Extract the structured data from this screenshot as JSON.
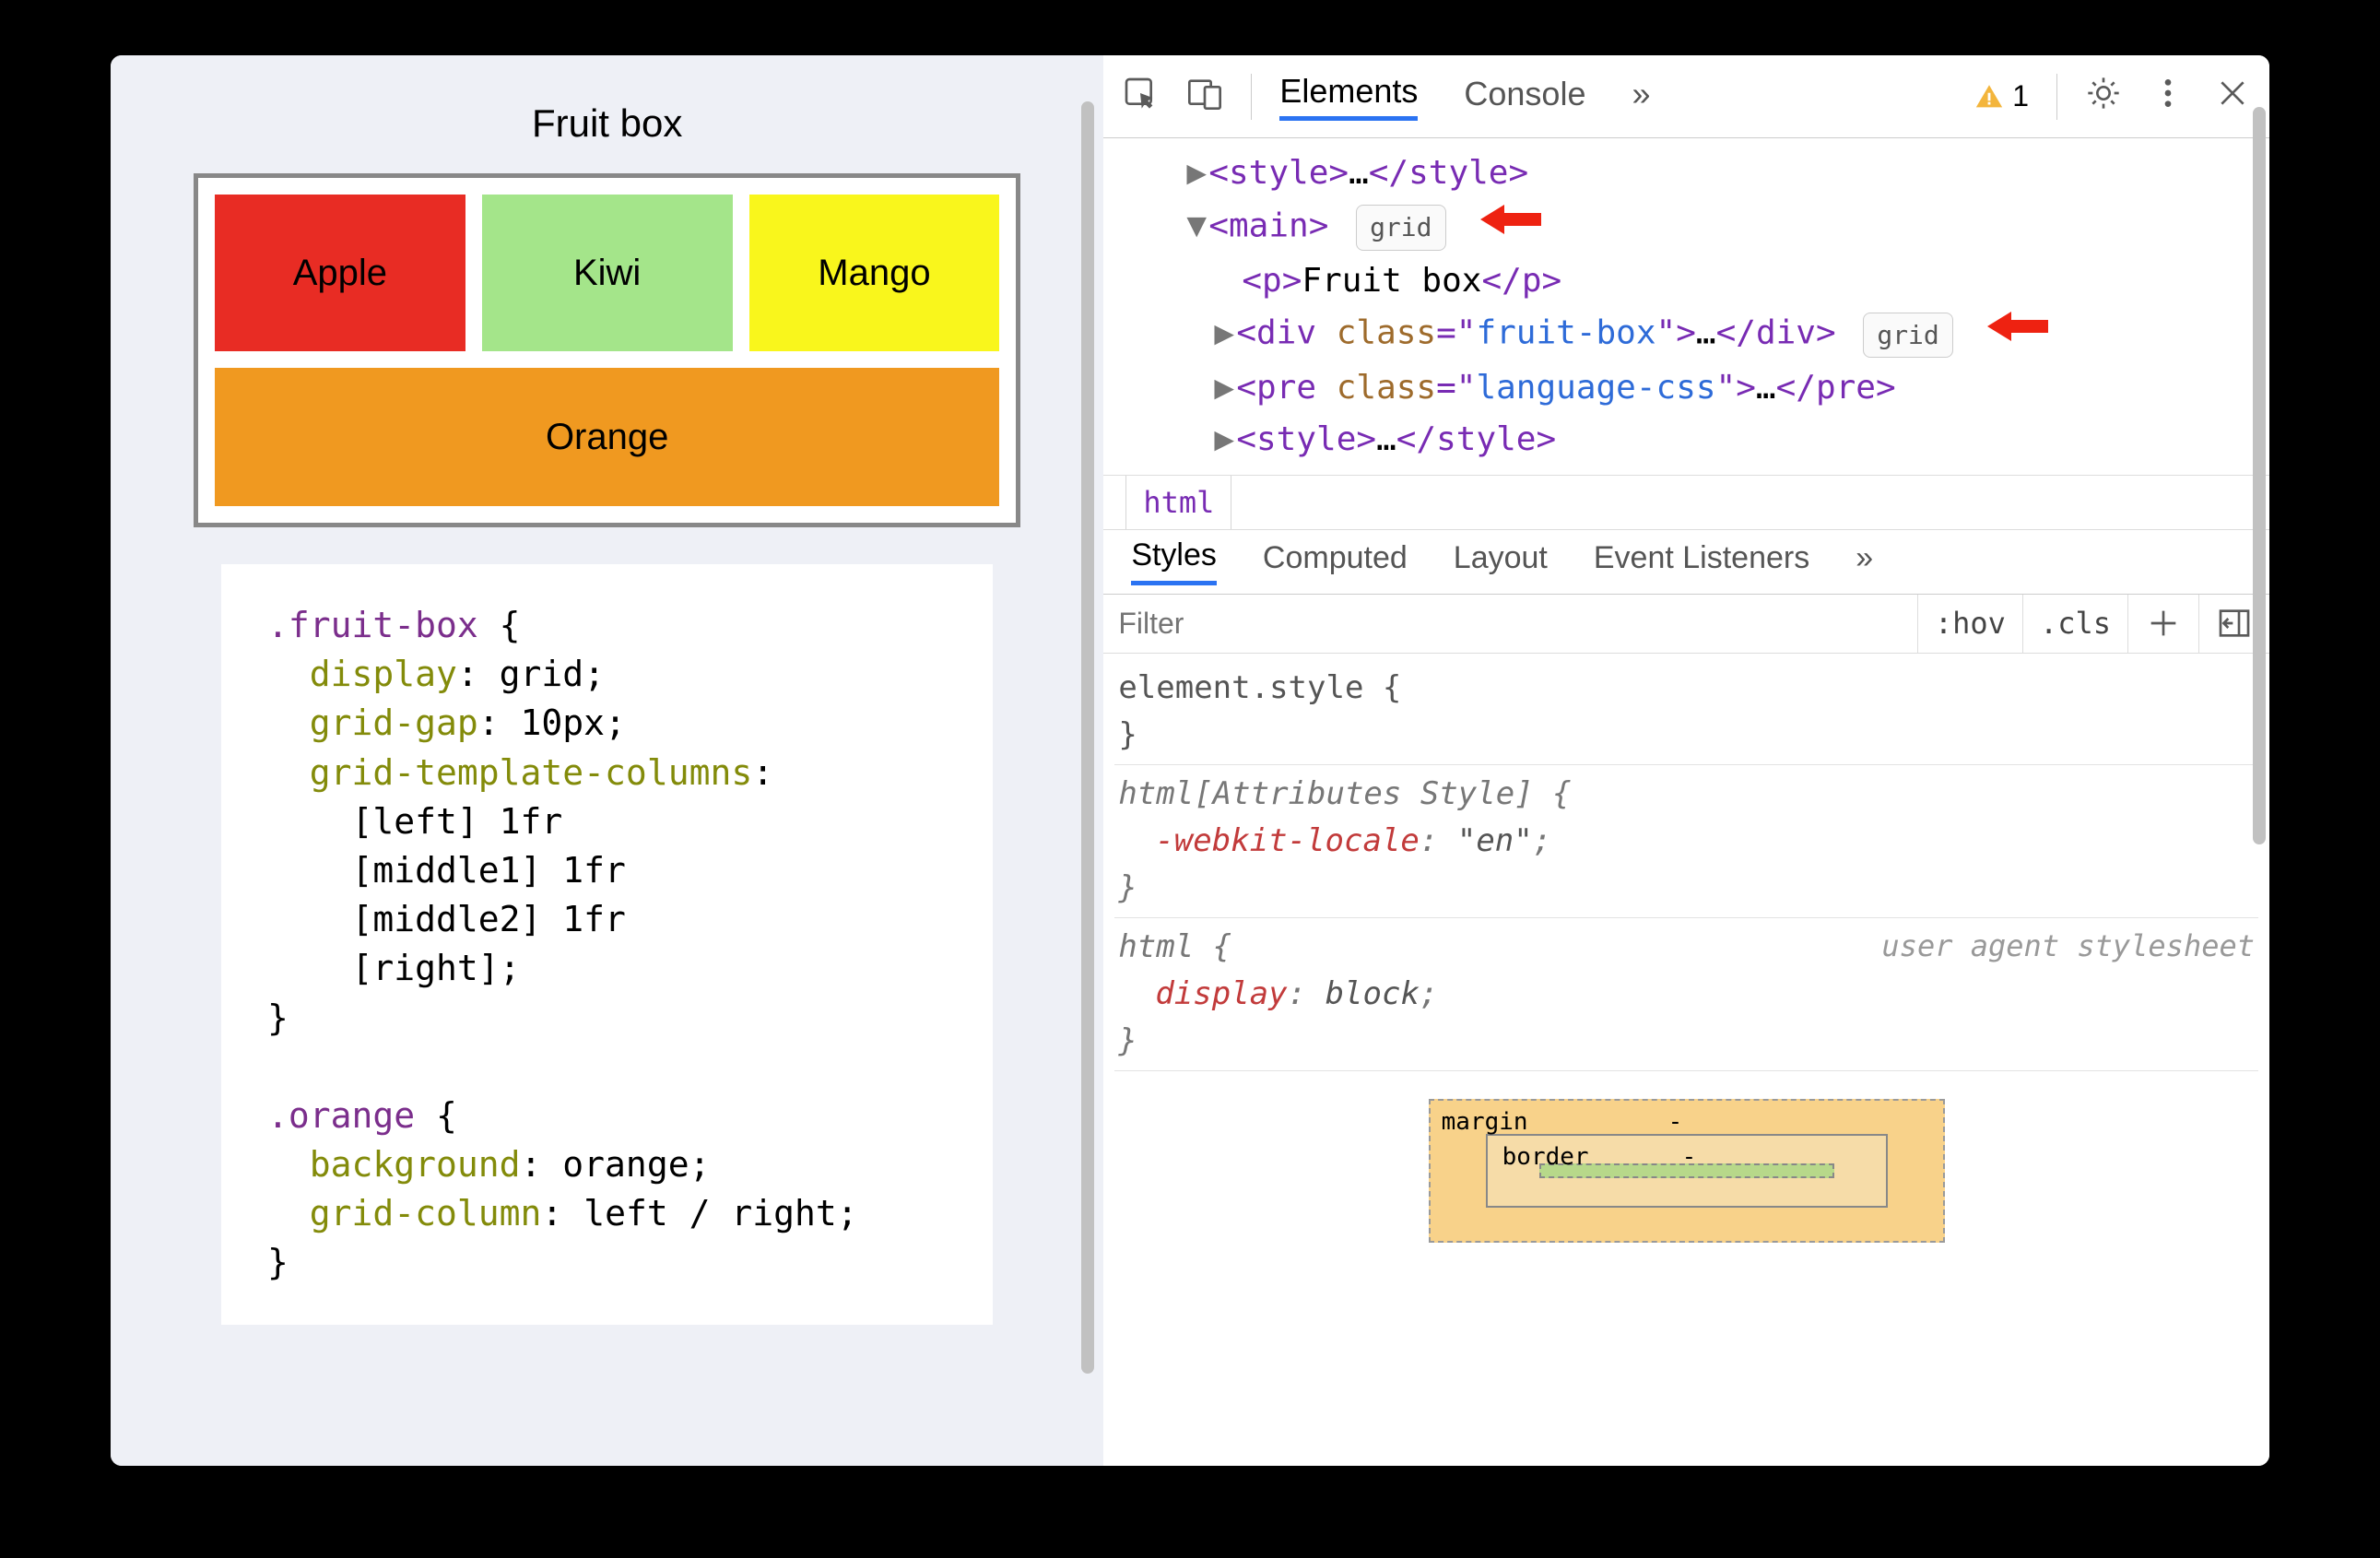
{
  "title": "Fruit box",
  "fruits": {
    "apple": "Apple",
    "kiwi": "Kiwi",
    "mango": "Mango",
    "orange": "Orange"
  },
  "code": ".fruit-box {\n  display: grid;\n  grid-gap: 10px;\n  grid-template-columns:\n    [left] 1fr\n    [middle1] 1fr\n    [middle2] 1fr\n    [right];\n}\n\n.orange {\n  background: orange;\n  grid-column: left / right;\n}",
  "devtools": {
    "tabs": {
      "elements": "Elements",
      "console": "Console",
      "more": "»"
    },
    "warning_count": "1",
    "badge": "grid",
    "breadcrumb": "html",
    "dom": {
      "style": "style",
      "main": "main",
      "p": "p",
      "p_text": "Fruit box",
      "div": "div",
      "div_class_attr": "class",
      "div_class_val": "fruit-box",
      "pre": "pre",
      "pre_class_val": "language-css",
      "ellipsis": "…"
    },
    "subtabs": {
      "styles": "Styles",
      "computed": "Computed",
      "layout": "Layout",
      "event": "Event Listeners",
      "more": "»"
    },
    "filter": {
      "placeholder": "Filter",
      "hov": ":hov",
      "cls": ".cls"
    },
    "rules": {
      "elstyle": "element.style {",
      "attr_sel": "html[Attributes Style] {",
      "locale_prop": "-webkit-locale",
      "locale_val": "\"en\"",
      "html_sel": "html {",
      "display_prop": "display",
      "display_val": "block",
      "uas": "user agent stylesheet",
      "close": "}"
    },
    "box": {
      "margin": "margin",
      "border": "border",
      "dash": "-"
    }
  }
}
